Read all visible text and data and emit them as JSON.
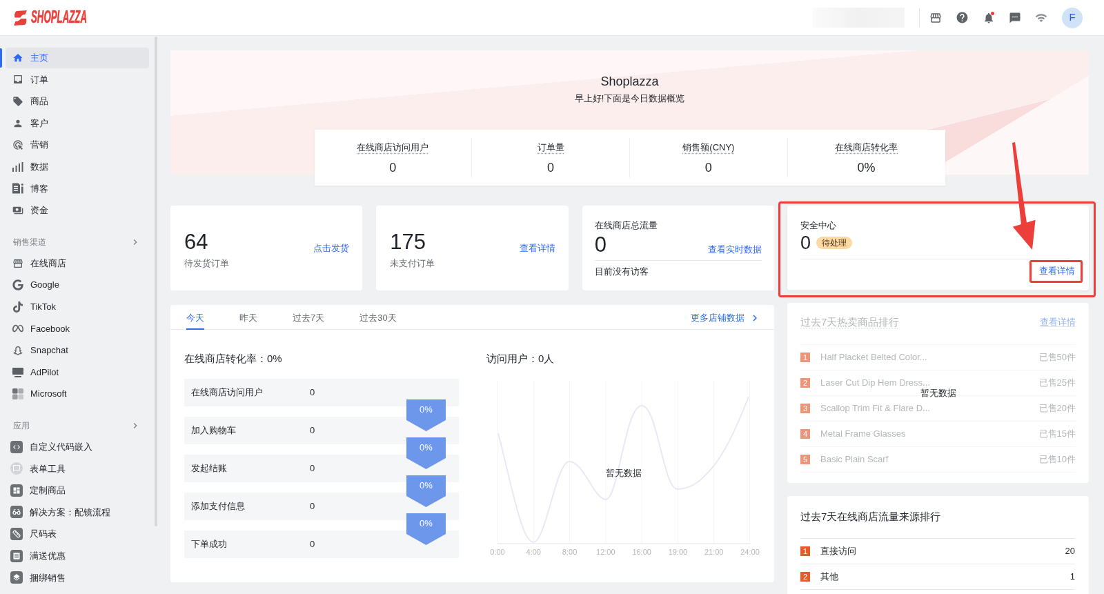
{
  "header": {
    "logo": "SHOPLAZZA",
    "unread": true,
    "avatar": "F"
  },
  "sidebar": {
    "items": [
      {
        "label": "主页",
        "selected": true
      },
      {
        "label": "订单",
        "selected": false
      },
      {
        "label": "商品",
        "selected": false
      },
      {
        "label": "客户",
        "selected": false
      },
      {
        "label": "营销",
        "selected": false
      },
      {
        "label": "数据",
        "selected": false
      },
      {
        "label": "博客",
        "selected": false
      },
      {
        "label": "资金",
        "selected": false
      }
    ],
    "sections": [
      {
        "title": "销售渠道",
        "items": [
          {
            "label": "在线商店",
            "selected": false
          },
          {
            "label": "Google",
            "selected": false
          },
          {
            "label": "TikTok",
            "selected": false
          },
          {
            "label": "Facebook",
            "selected": false
          },
          {
            "label": "Snapchat",
            "selected": false
          },
          {
            "label": "AdPilot",
            "selected": false
          },
          {
            "label": "Microsoft",
            "selected": false
          }
        ]
      },
      {
        "title": "应用",
        "items": [
          {
            "label": "自定义代码嵌入",
            "selected": false
          },
          {
            "label": "表单工具",
            "selected": false
          },
          {
            "label": "定制商品",
            "selected": false
          },
          {
            "label": "解决方案：配镜流程",
            "selected": false
          },
          {
            "label": "尺码表",
            "selected": false
          },
          {
            "label": "满送优惠",
            "selected": false
          },
          {
            "label": "捆绑销售",
            "selected": false
          }
        ]
      }
    ]
  },
  "banner": {
    "title": "Shoplazza",
    "greeting": "早上好!下面是今日数据概览",
    "stats": [
      {
        "label": "在线商店访问用户",
        "value": "0"
      },
      {
        "label": "订单量",
        "value": "0"
      },
      {
        "label": "销售额(CNY)",
        "value": "0"
      },
      {
        "label": "在线商店转化率",
        "value": "0%"
      }
    ]
  },
  "summary_cards": [
    {
      "kind": "count",
      "value": "64",
      "label": "待发货订单",
      "link": "点击发货"
    },
    {
      "kind": "count",
      "value": "175",
      "label": "未支付订单",
      "link": "查看详情"
    },
    {
      "kind": "traffic",
      "title": "在线商店总流量",
      "value": "0",
      "link": "查看实时数据",
      "note": "目前没有访客"
    }
  ],
  "security": {
    "title": "安全中心",
    "value": "0",
    "badge": "待处理",
    "link": "查看详情"
  },
  "overview": {
    "tabs": [
      {
        "label": "今天",
        "selected": true
      },
      {
        "label": "昨天",
        "selected": false
      },
      {
        "label": "过去7天",
        "selected": false
      },
      {
        "label": "过去30天",
        "selected": false
      }
    ],
    "more_link": "更多店铺数据",
    "funnel": {
      "title": "在线商店转化率：0%",
      "steps": [
        {
          "label": "在线商店访问用户",
          "value": "0",
          "rate": "0%"
        },
        {
          "label": "加入购物车",
          "value": "0",
          "rate": "0%"
        },
        {
          "label": "发起结账",
          "value": "0",
          "rate": "0%"
        },
        {
          "label": "添加支付信息",
          "value": "0",
          "rate": "0%"
        },
        {
          "label": "下单成功",
          "value": "0"
        }
      ]
    },
    "visitors": {
      "title": "访问用户：0人",
      "x_labels": [
        "0:00",
        "4:00",
        "8:00",
        "12:00",
        "16:00",
        "19:00",
        "21:00",
        "24:00"
      ],
      "empty_text": "暂无数据"
    }
  },
  "hot_products": {
    "title": "过去7天热卖商品排行",
    "link": "查看详情",
    "items": [
      {
        "rank": "1",
        "name": "Half Placket Belted Color...",
        "sold": "已售50件"
      },
      {
        "rank": "2",
        "name": "Laser Cut Dip Hem Dress...",
        "sold": "已售25件"
      },
      {
        "rank": "3",
        "name": "Scallop Trim Fit & Flare D...",
        "sold": "已售20件"
      },
      {
        "rank": "4",
        "name": "Metal Frame Glasses",
        "sold": "已售15件"
      },
      {
        "rank": "5",
        "name": "Basic Plain Scarf",
        "sold": "已售10件"
      }
    ],
    "empty_text": "暂无数据"
  },
  "traffic_sources": {
    "title": "过去7天在线商店流量来源排行",
    "items": [
      {
        "rank": "1",
        "name": "直接访问",
        "value": "20"
      },
      {
        "rank": "2",
        "name": "其他",
        "value": "1"
      }
    ]
  }
}
